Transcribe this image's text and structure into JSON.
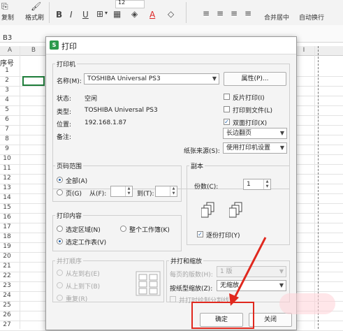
{
  "ribbon": {
    "copy_label": "复制",
    "format_painter_label": "格式刷",
    "bold_label": "B",
    "italic_label": "I",
    "underline_label": "U",
    "font_size_value": "12",
    "font_color_label": "A",
    "merge_center_label": "合并居中",
    "auto_wrap_label": "自动换行"
  },
  "formula_bar": {
    "cell_ref": "B3"
  },
  "sheet": {
    "col_a": "A",
    "col_b": "B",
    "col_i": "I",
    "a1_text": "序号",
    "row_numbers": [
      "1",
      "2",
      "3",
      "4",
      "5",
      "6",
      "7",
      "8",
      "9",
      "10",
      "11",
      "12",
      "13",
      "14",
      "15",
      "16",
      "17",
      "18",
      "19",
      "20",
      "21",
      "22",
      "23",
      "24",
      "25",
      "26",
      "27"
    ]
  },
  "dialog": {
    "title": "打印",
    "printer_group": {
      "title": "打印机",
      "name_label": "名称(M):",
      "name_value": "TOSHIBA Universal PS3",
      "properties_button": "属性(P)...",
      "status_label": "状态:",
      "status_value": "空闲",
      "type_label": "类型:",
      "type_value": "TOSHIBA Universal PS3",
      "location_label": "位置:",
      "location_value": "192.168.1.87",
      "comment_label": "备注:",
      "reverse_print_label": "反片打印(I)",
      "print_to_file_label": "打印到文件(L)",
      "duplex_label": "双面打印(X)",
      "duplex_mode_value": "长边翻页",
      "paper_source_label": "纸张来源(S):",
      "paper_source_value": "使用打印机设置"
    },
    "page_range_group": {
      "title": "页码范围",
      "all_label": "全部(A)",
      "pages_label": "页(G)",
      "from_label": "从(F):",
      "to_label": "到(T):"
    },
    "copies_group": {
      "title": "副本",
      "copies_label": "份数(C):",
      "copies_value": "1",
      "collate_label": "逐份打印(Y)"
    },
    "print_what_group": {
      "title": "打印内容",
      "selection_label": "选定区域(N)",
      "entire_workbook_label": "整个工作簿(K)",
      "active_sheets_label": "选定工作表(V)"
    },
    "print_order_group": {
      "title": "并打顺序",
      "left_to_right_label": "从左到右(E)",
      "top_to_bottom_label": "从上到下(B)",
      "repeat_label": "重复(R)"
    },
    "zoom_group": {
      "title": "并打和缩放",
      "pages_per_sheet_label": "每页的版数(H):",
      "pages_per_sheet_value": "1 版",
      "scale_to_paper_label": "按纸型缩放(Z):",
      "scale_to_paper_value": "无缩放",
      "sheet_separator_label": "并打时绘制分割线"
    },
    "ok_button": "确定",
    "close_button": "关闭"
  }
}
